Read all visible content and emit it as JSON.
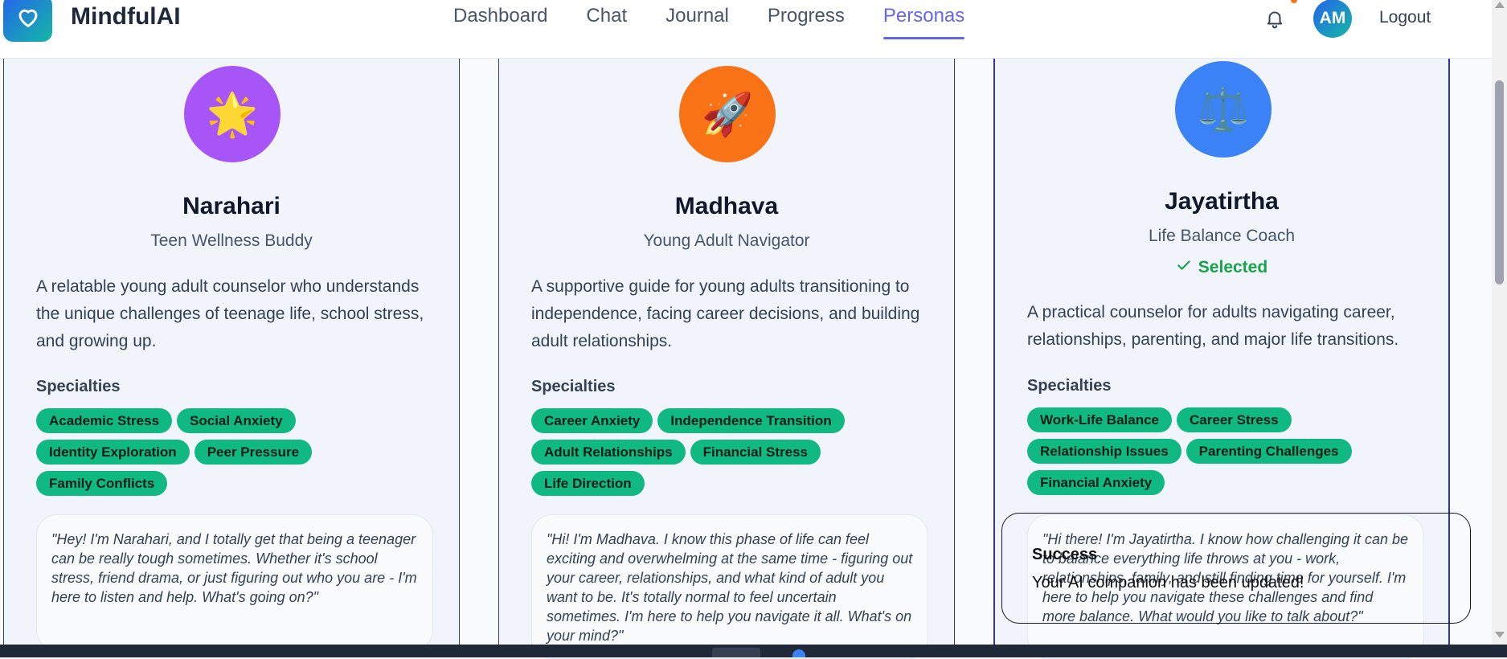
{
  "header": {
    "brand": "MindfulAI",
    "nav": [
      "Dashboard",
      "Chat",
      "Journal",
      "Progress",
      "Personas"
    ],
    "active_nav": "Personas",
    "avatar_initials": "AM",
    "logout_label": "Logout",
    "icons": {
      "logo": "heart-icon",
      "notifications": "bell-icon"
    }
  },
  "personas": [
    {
      "name": "Narahari",
      "role": "Teen Wellness Buddy",
      "emoji": "🌟",
      "color": "#a855f7",
      "description": "A relatable young adult counselor who understands the unique challenges of teenage life, school stress, and growing up.",
      "specialties_label": "Specialties",
      "specialties": [
        "Academic Stress",
        "Social Anxiety",
        "Identity Exploration",
        "Peer Pressure",
        "Family Conflicts"
      ],
      "quote": "\"Hey! I'm Narahari, and I totally get that being a teenager can be really tough sometimes. Whether it's school stress, friend drama, or just figuring out who you are - I'm here to listen and help. What's going on?\""
    },
    {
      "name": "Madhava",
      "role": "Young Adult Navigator",
      "emoji": "🚀",
      "color": "#f97316",
      "description": "A supportive guide for young adults transitioning to independence, facing career decisions, and building adult relationships.",
      "specialties_label": "Specialties",
      "specialties": [
        "Career Anxiety",
        "Independence Transition",
        "Adult Relationships",
        "Financial Stress",
        "Life Direction"
      ],
      "quote": "\"Hi! I'm Madhava. I know this phase of life can feel exciting and overwhelming at the same time - figuring out your career, relationships, and what kind of adult you want to be. It's totally normal to feel uncertain sometimes. I'm here to help you navigate it all. What's on your mind?\""
    },
    {
      "name": "Jayatirtha",
      "role": "Life Balance Coach",
      "emoji": "⚖️",
      "color": "#3b82f6",
      "selected_label": "Selected",
      "description": "A practical counselor for adults navigating career, relationships, parenting, and major life transitions.",
      "specialties_label": "Specialties",
      "specialties": [
        "Work-Life Balance",
        "Career Stress",
        "Relationship Issues",
        "Parenting Challenges",
        "Financial Anxiety"
      ],
      "quote": "\"Hi there! I'm Jayatirtha. I know how challenging it can be to balance everything life throws at you - work, relationships, family, and still finding time for yourself. I'm here to help you navigate these challenges and find more balance. What would you like to talk about?\""
    }
  ],
  "toast": {
    "title": "Success",
    "message": "Your AI companion has been updated!"
  },
  "colors": {
    "accent": "#6366f1",
    "tag": "#10b981",
    "selected": "#16a34a"
  }
}
